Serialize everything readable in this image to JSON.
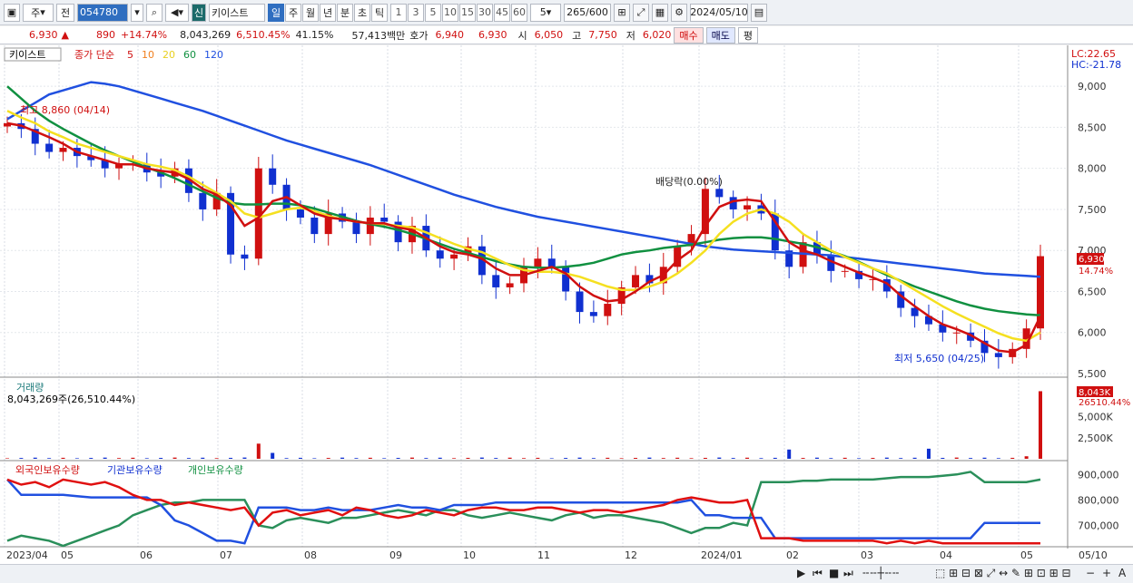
{
  "toolbar": {
    "market": "주",
    "price_type": "전",
    "code": "054780",
    "name_badge": "신",
    "name": "키이스트",
    "periods": [
      "일",
      "주",
      "월",
      "년",
      "분",
      "초",
      "틱"
    ],
    "active_period": "일",
    "intervals": [
      "1",
      "3",
      "5",
      "10",
      "15",
      "30",
      "45",
      "60"
    ],
    "interval": "5",
    "count": "265/600",
    "date": "2024/05/10"
  },
  "quote": {
    "price": "6,930",
    "arrow": "▲",
    "change": "890",
    "pct": "+14.74%",
    "volume": "8,043,269",
    "vol_ratio": "6,510.45%",
    "turnover": "41.15%",
    "amount": "57,413백만",
    "hoga_label": "호가",
    "hoga_ask": "6,940",
    "hoga_bid": "6,930",
    "open_label": "시",
    "open": "6,050",
    "high_label": "고",
    "high": "7,750",
    "low_label": "저",
    "low": "6,020",
    "buy": "매수",
    "sell": "매도",
    "avg": "평"
  },
  "main_panel": {
    "stock": "키이스트",
    "ma_title": "종가 단순",
    "ma": [
      {
        "p": "5",
        "c": "#d01010"
      },
      {
        "p": "10",
        "c": "#f08020"
      },
      {
        "p": "20",
        "c": "#e8d020"
      },
      {
        "p": "60",
        "c": "#109040"
      },
      {
        "p": "120",
        "c": "#2050e0"
      }
    ],
    "lc": "LC:22.65",
    "hc": "HC:-21.78",
    "high_mark": "최고 8,860 (04/14)",
    "low_mark": "최저 5,650 (04/25)",
    "ex_div": "배당락(0.00%)",
    "last_label": "6,930",
    "last_pct": "14.74%",
    "yticks": [
      "9,000",
      "8,500",
      "8,000",
      "7,500",
      "7,000",
      "6,500",
      "6,000",
      "5,500"
    ]
  },
  "volume_panel": {
    "title": "거래량",
    "value": "8,043,269주(26,510.44%)",
    "last_label": "8,043K",
    "last_pct": "26510.44%",
    "yticks": [
      "5,000K",
      "2,500K"
    ]
  },
  "holding_panel": {
    "title1": "외국인보유수량",
    "title2": "기관보유수량",
    "title3": "개인보유수량",
    "yticks": [
      "900,000",
      "800,000",
      "700,000"
    ]
  },
  "xaxis": [
    "2023/04",
    "05",
    "06",
    "07",
    "08",
    "09",
    "10",
    "11",
    "12",
    "2024/01",
    "02",
    "03",
    "04",
    "05",
    "05/10"
  ],
  "chart_data": {
    "type": "line",
    "price": {
      "unit": "KRW",
      "ylim": [
        5500,
        9300
      ],
      "close": [
        8550,
        8480,
        8300,
        8200,
        8250,
        8150,
        8100,
        8000,
        8050,
        8050,
        7950,
        7900,
        8000,
        7700,
        7500,
        7700,
        6950,
        6900,
        8000,
        7800,
        7500,
        7400,
        7200,
        7450,
        7350,
        7200,
        7400,
        7350,
        7100,
        7300,
        7000,
        6900,
        6950,
        7050,
        6700,
        6550,
        6600,
        6800,
        6900,
        6800,
        6500,
        6250,
        6200,
        6350,
        6550,
        6700,
        6600,
        6800,
        7050,
        7200,
        7750,
        7650,
        7500,
        7550,
        7450,
        7000,
        6800,
        7100,
        6950,
        6750,
        6750,
        6650,
        6650,
        6500,
        6300,
        6200,
        6100,
        6000,
        6000,
        5900,
        5750,
        5700,
        5800,
        6050,
        6930
      ],
      "ma5": [
        8550,
        8520,
        8450,
        8380,
        8300,
        8200,
        8150,
        8100,
        8050,
        8050,
        8000,
        7970,
        7950,
        7870,
        7750,
        7680,
        7550,
        7300,
        7400,
        7600,
        7650,
        7550,
        7450,
        7400,
        7380,
        7350,
        7330,
        7330,
        7280,
        7250,
        7150,
        7050,
        6980,
        6950,
        6900,
        6780,
        6700,
        6700,
        6750,
        6800,
        6720,
        6560,
        6450,
        6380,
        6400,
        6500,
        6620,
        6700,
        6880,
        7000,
        7300,
        7530,
        7600,
        7620,
        7600,
        7350,
        7100,
        7000,
        6950,
        6870,
        6800,
        6730,
        6670,
        6600,
        6450,
        6320,
        6200,
        6100,
        6040,
        5970,
        5870,
        5780,
        5760,
        5850,
        6200
      ],
      "ma20": [
        8700,
        8620,
        8550,
        8450,
        8380,
        8300,
        8250,
        8200,
        8150,
        8100,
        8050,
        8020,
        7980,
        7900,
        7800,
        7700,
        7600,
        7450,
        7400,
        7450,
        7500,
        7520,
        7480,
        7420,
        7380,
        7350,
        7330,
        7320,
        7300,
        7280,
        7220,
        7150,
        7080,
        7020,
        6980,
        6900,
        6820,
        6760,
        6740,
        6740,
        6720,
        6680,
        6620,
        6560,
        6520,
        6520,
        6560,
        6620,
        6720,
        6850,
        7000,
        7200,
        7350,
        7450,
        7500,
        7450,
        7350,
        7200,
        7100,
        7000,
        6920,
        6850,
        6780,
        6720,
        6620,
        6520,
        6420,
        6320,
        6230,
        6150,
        6070,
        5990,
        5930,
        5900,
        6000
      ],
      "ma60": [
        9000,
        8850,
        8700,
        8580,
        8480,
        8390,
        8300,
        8220,
        8150,
        8080,
        8010,
        7950,
        7880,
        7800,
        7720,
        7640,
        7580,
        7560,
        7560,
        7570,
        7570,
        7550,
        7510,
        7460,
        7410,
        7360,
        7320,
        7290,
        7250,
        7200,
        7140,
        7080,
        7020,
        6970,
        6920,
        6870,
        6830,
        6800,
        6790,
        6790,
        6800,
        6820,
        6850,
        6900,
        6950,
        6980,
        7000,
        7030,
        7050,
        7070,
        7100,
        7130,
        7150,
        7160,
        7160,
        7140,
        7110,
        7080,
        7040,
        6990,
        6930,
        6860,
        6780,
        6700,
        6630,
        6560,
        6500,
        6440,
        6380,
        6330,
        6290,
        6260,
        6240,
        6220,
        6210
      ],
      "ma120": [
        8600,
        8700,
        8800,
        8900,
        8950,
        9000,
        9050,
        9030,
        9000,
        8950,
        8900,
        8850,
        8800,
        8750,
        8700,
        8640,
        8580,
        8520,
        8460,
        8400,
        8340,
        8290,
        8240,
        8190,
        8140,
        8090,
        8040,
        7980,
        7920,
        7860,
        7800,
        7740,
        7680,
        7630,
        7580,
        7530,
        7490,
        7450,
        7410,
        7380,
        7350,
        7320,
        7290,
        7260,
        7230,
        7200,
        7170,
        7140,
        7110,
        7080,
        7050,
        7030,
        7010,
        7000,
        6990,
        6980,
        6970,
        6960,
        6950,
        6940,
        6920,
        6900,
        6880,
        6860,
        6840,
        6820,
        6800,
        6780,
        6760,
        6740,
        6720,
        6710,
        6700,
        6690,
        6680
      ]
    },
    "volume": {
      "unit": "K",
      "ylim": [
        0,
        8200
      ],
      "spikes": [
        {
          "i": 18,
          "v": 1800
        },
        {
          "i": 19,
          "v": 700
        },
        {
          "i": 56,
          "v": 1100
        },
        {
          "i": 66,
          "v": 1200
        },
        {
          "i": 73,
          "v": 300
        },
        {
          "i": 74,
          "v": 8043
        }
      ]
    },
    "holdings": {
      "ylim": [
        620000,
        940000
      ],
      "foreign": [
        880000,
        860000,
        870000,
        850000,
        880000,
        870000,
        860000,
        870000,
        850000,
        820000,
        800000,
        800000,
        780000,
        790000,
        780000,
        770000,
        760000,
        770000,
        700000,
        750000,
        760000,
        740000,
        750000,
        760000,
        740000,
        770000,
        760000,
        740000,
        730000,
        740000,
        760000,
        750000,
        740000,
        760000,
        770000,
        770000,
        760000,
        760000,
        770000,
        770000,
        760000,
        750000,
        760000,
        760000,
        750000,
        760000,
        770000,
        780000,
        800000,
        810000,
        800000,
        790000,
        790000,
        800000,
        650000,
        650000,
        650000,
        640000,
        640000,
        640000,
        640000,
        640000,
        640000,
        630000,
        640000,
        630000,
        640000,
        630000,
        630000,
        630000,
        630000,
        630000,
        630000,
        630000,
        630000
      ],
      "institution": [
        880000,
        820000,
        820000,
        820000,
        820000,
        815000,
        810000,
        810000,
        810000,
        810000,
        810000,
        780000,
        720000,
        700000,
        670000,
        640000,
        640000,
        630000,
        770000,
        770000,
        770000,
        760000,
        760000,
        770000,
        760000,
        760000,
        760000,
        770000,
        780000,
        770000,
        770000,
        760000,
        780000,
        780000,
        780000,
        790000,
        790000,
        790000,
        790000,
        790000,
        790000,
        790000,
        790000,
        790000,
        790000,
        790000,
        790000,
        790000,
        790000,
        800000,
        740000,
        740000,
        730000,
        730000,
        730000,
        650000,
        650000,
        650000,
        650000,
        650000,
        650000,
        650000,
        650000,
        650000,
        650000,
        650000,
        650000,
        650000,
        650000,
        650000,
        710000,
        710000,
        710000,
        710000,
        710000
      ],
      "individual": [
        640000,
        660000,
        650000,
        640000,
        620000,
        640000,
        660000,
        680000,
        700000,
        740000,
        760000,
        780000,
        790000,
        790000,
        800000,
        800000,
        800000,
        800000,
        700000,
        690000,
        720000,
        730000,
        720000,
        710000,
        730000,
        730000,
        740000,
        750000,
        760000,
        750000,
        740000,
        760000,
        760000,
        740000,
        730000,
        740000,
        750000,
        740000,
        730000,
        720000,
        740000,
        750000,
        730000,
        740000,
        740000,
        730000,
        720000,
        710000,
        690000,
        670000,
        690000,
        690000,
        710000,
        700000,
        870000,
        870000,
        870000,
        875000,
        875000,
        880000,
        880000,
        880000,
        880000,
        885000,
        890000,
        890000,
        890000,
        895000,
        900000,
        910000,
        870000,
        870000,
        870000,
        870000,
        880000
      ]
    }
  }
}
